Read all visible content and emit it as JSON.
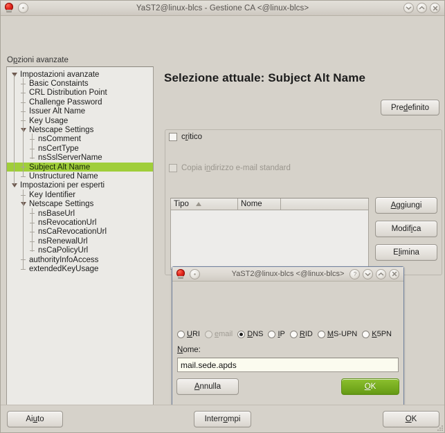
{
  "window": {
    "title": "YaST2@linux-blcs - Gestione CA <@linux-blcs>",
    "icon": "yast-icon",
    "menu_button_icon": "window-menu-icon",
    "controls": [
      {
        "name": "minimize-button",
        "icon": "chevron-down-icon"
      },
      {
        "name": "maximize-button",
        "icon": "chevron-up-icon"
      },
      {
        "name": "close-button",
        "icon": "close-x-icon"
      }
    ]
  },
  "tree": {
    "label": "Opzioni avanzate",
    "selected": "Subject Alt Name",
    "selection_color": "#a0ce3a",
    "nodes": [
      {
        "label": "Impostazioni avanzate",
        "indent": 0,
        "type": "expanded"
      },
      {
        "label": "Basic Constaints",
        "indent": 1,
        "type": "leaf"
      },
      {
        "label": "CRL Distribution Point",
        "indent": 1,
        "type": "leaf"
      },
      {
        "label": "Challenge Password",
        "indent": 1,
        "type": "leaf"
      },
      {
        "label": "Issuer Alt Name",
        "indent": 1,
        "type": "leaf"
      },
      {
        "label": "Key Usage",
        "indent": 1,
        "type": "leaf"
      },
      {
        "label": "Netscape Settings",
        "indent": 1,
        "type": "expanded"
      },
      {
        "label": "nsComment",
        "indent": 2,
        "type": "leaf"
      },
      {
        "label": "nsCertType",
        "indent": 2,
        "type": "leaf"
      },
      {
        "label": "nsSslServerName",
        "indent": 2,
        "type": "leaf"
      },
      {
        "label": "Subject Alt Name",
        "indent": 1,
        "type": "leaf",
        "selected": true
      },
      {
        "label": "Unstructured Name",
        "indent": 1,
        "type": "leaf"
      },
      {
        "label": "Impostazioni per esperti",
        "indent": 0,
        "type": "expanded"
      },
      {
        "label": "Key Identifier",
        "indent": 1,
        "type": "leaf"
      },
      {
        "label": "Netscape Settings",
        "indent": 1,
        "type": "expanded"
      },
      {
        "label": "nsBaseUrl",
        "indent": 2,
        "type": "leaf"
      },
      {
        "label": "nsRevocationUrl",
        "indent": 2,
        "type": "leaf"
      },
      {
        "label": "nsCaRevocationUrl",
        "indent": 2,
        "type": "leaf"
      },
      {
        "label": "nsRenewalUrl",
        "indent": 2,
        "type": "leaf"
      },
      {
        "label": "nsCaPolicyUrl",
        "indent": 2,
        "type": "leaf"
      },
      {
        "label": "authorityInfoAccess",
        "indent": 1,
        "type": "leaf"
      },
      {
        "label": "extendedKeyUsage",
        "indent": 1,
        "type": "leaf"
      }
    ]
  },
  "main": {
    "heading": "Selezione attuale: Subject Alt Name",
    "default_button": "Predefinito",
    "critico_label": "critico",
    "critico_checked": false,
    "copy_email_label": "Copia indirizzo e-mail standard",
    "copy_email_checked": false,
    "copy_email_enabled": false,
    "table": {
      "columns": [
        "Tipo",
        "Nome"
      ],
      "sort_column": "Tipo",
      "sort_direction": "ascending",
      "rows": []
    },
    "side_buttons": {
      "add": "Aggiungi",
      "edit": "Modifica",
      "delete": "Elimina"
    }
  },
  "footer": {
    "help": "Aiuto",
    "abort": "Interrompi",
    "ok": "OK"
  },
  "dialog": {
    "title": "YaST2@linux-blcs <@linux-blcs>",
    "icon": "yast-icon",
    "menu_button_icon": "window-menu-icon",
    "controls": [
      {
        "name": "help-button",
        "icon": "question-mark-icon"
      },
      {
        "name": "minimize-button",
        "icon": "chevron-down-icon"
      },
      {
        "name": "maximize-button",
        "icon": "chevron-up-icon"
      },
      {
        "name": "close-button",
        "icon": "close-x-icon"
      }
    ],
    "radios": [
      {
        "label": "URI",
        "selected": false,
        "enabled": true
      },
      {
        "label": "email",
        "selected": false,
        "enabled": false
      },
      {
        "label": "DNS",
        "selected": true,
        "enabled": true
      },
      {
        "label": "IP",
        "selected": false,
        "enabled": true
      },
      {
        "label": "RID",
        "selected": false,
        "enabled": true
      },
      {
        "label": "MS-UPN",
        "selected": false,
        "enabled": true
      },
      {
        "label": "K5PN",
        "selected": false,
        "enabled": true
      }
    ],
    "name_label": "Nome:",
    "name_value": "mail.sede.apds",
    "name_placeholder": "",
    "cancel_button": "Annulla",
    "ok_button": "OK",
    "ok_button_color": "#79ae21"
  }
}
